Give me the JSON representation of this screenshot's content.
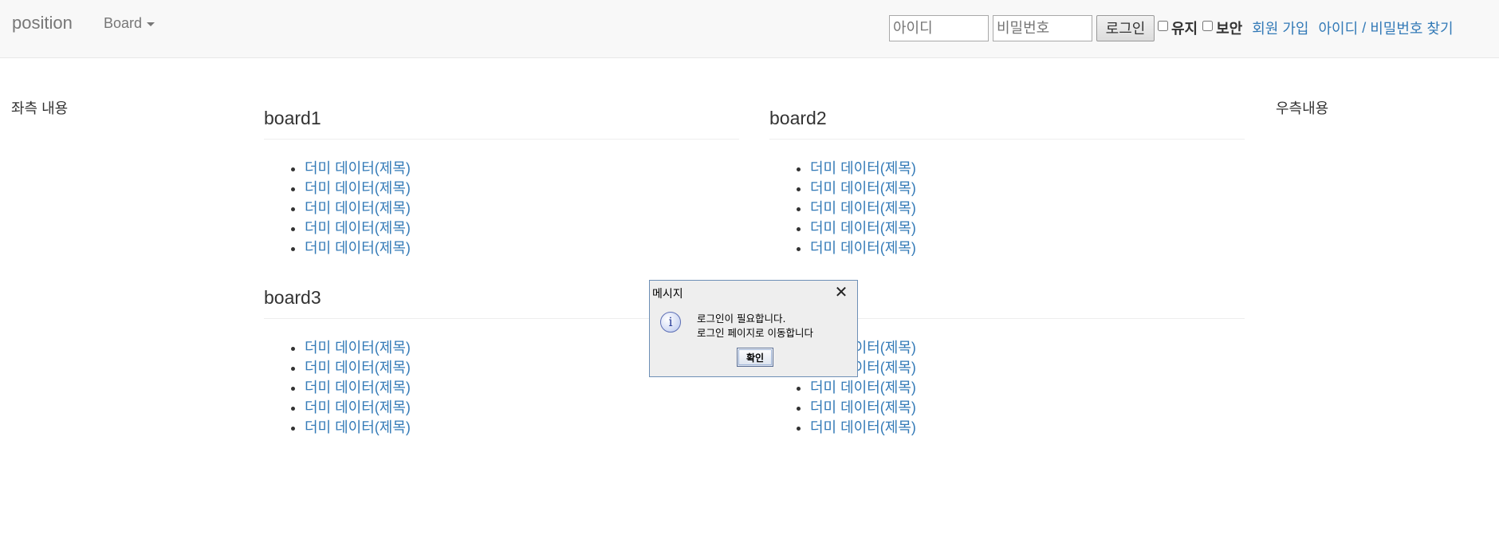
{
  "navbar": {
    "brand": "position",
    "dropdown_label": "Board",
    "id_placeholder": "아이디",
    "pw_placeholder": "비밀번호",
    "login_button": "로그인",
    "keep_label": "유지",
    "secure_label": "보안",
    "signup_link": "회원 가입",
    "find_id_link": "아이디",
    "separator": "/",
    "find_pw_link": "비밀번호 찾기"
  },
  "left_sidebar": {
    "text": "좌측 내용"
  },
  "right_sidebar": {
    "text": "우측내용"
  },
  "boards": [
    {
      "title": "board1",
      "items": [
        "더미 데이터(제목)",
        "더미 데이터(제목)",
        "더미 데이터(제목)",
        "더미 데이터(제목)",
        "더미 데이터(제목)"
      ]
    },
    {
      "title": "board2",
      "items": [
        "더미 데이터(제목)",
        "더미 데이터(제목)",
        "더미 데이터(제목)",
        "더미 데이터(제목)",
        "더미 데이터(제목)"
      ]
    },
    {
      "title": "board3",
      "items": [
        "더미 데이터(제목)",
        "더미 데이터(제목)",
        "더미 데이터(제목)",
        "더미 데이터(제목)",
        "더미 데이터(제목)"
      ]
    },
    {
      "title": "",
      "items": [
        "더미 데이터(제목)",
        "더미 데이터(제목)",
        "더미 데이터(제목)",
        "더미 데이터(제목)",
        "더미 데이터(제목)"
      ]
    }
  ],
  "dialog": {
    "title": "메시지",
    "icon": "info-icon",
    "icon_glyph": "i",
    "message_line1": "로그인이 필요합니다.",
    "message_line2": "로그인 페이지로 이동합니다",
    "ok_button": "확인"
  }
}
